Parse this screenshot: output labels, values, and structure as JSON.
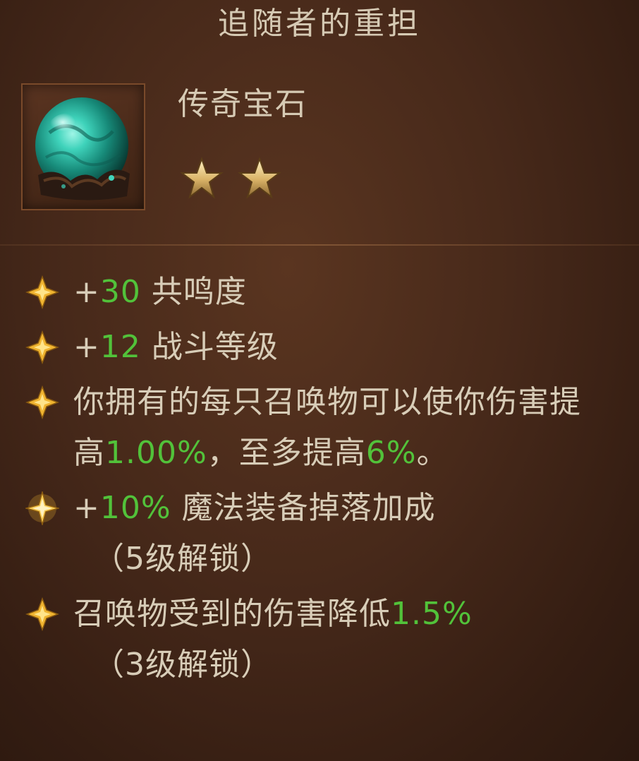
{
  "item": {
    "name": "追随者的重担",
    "type": "传奇宝石",
    "stars": 2,
    "icon": "teal-gem-icon"
  },
  "affixes": [
    {
      "prefix": "+",
      "value": "30",
      "text": " 共鸣度"
    },
    {
      "prefix": "+",
      "value": "12",
      "text": " 战斗等级"
    },
    {
      "text1": "你拥有的每只召唤物可以使你伤害提高",
      "value1": "1.00%",
      "text2": "，至多提高",
      "value2": "6%",
      "text3": "。"
    },
    {
      "prefix": "+",
      "value": "10%",
      "text": " 魔法装备掉落加成",
      "unlock": "（5级解锁）"
    },
    {
      "text": "召唤物受到的伤害降低",
      "value": "1.5%",
      "unlock": "（3级解锁）"
    }
  ],
  "colors": {
    "value_green": "#52c23a",
    "text": "#d8cdb8",
    "bullet_gold": "#f0b430"
  }
}
